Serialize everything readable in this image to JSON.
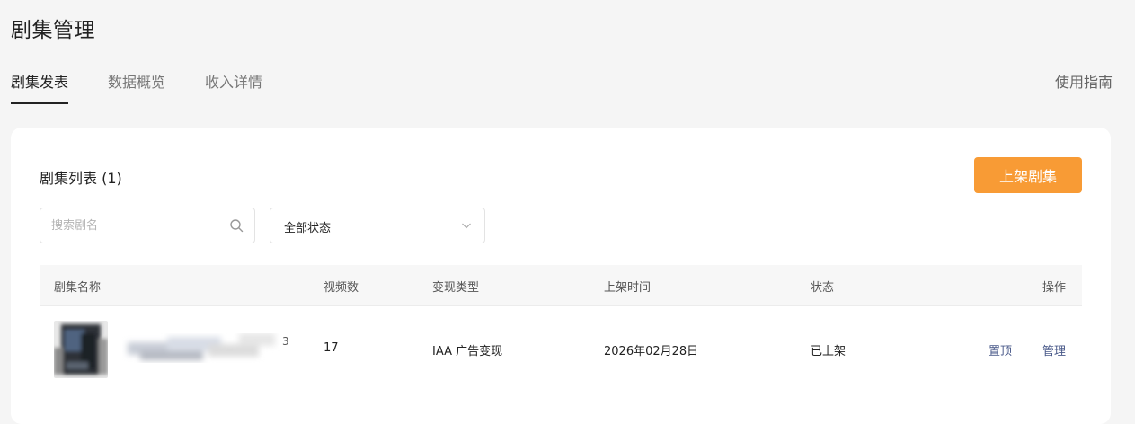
{
  "page": {
    "title": "剧集管理"
  },
  "tabs": [
    {
      "label": "剧集发表",
      "active": true
    },
    {
      "label": "数据概览",
      "active": false
    },
    {
      "label": "收入详情",
      "active": false
    }
  ],
  "guide_link": "使用指南",
  "list": {
    "title": "剧集列表 (1)",
    "publish_button": "上架剧集",
    "search": {
      "placeholder": "搜索剧名",
      "value": ""
    },
    "status_filter": {
      "selected": "全部状态"
    },
    "columns": [
      "剧集名称",
      "视频数",
      "变现类型",
      "上架时间",
      "状态",
      "操作"
    ],
    "rows": [
      {
        "name_visible": "3",
        "video_count": "17",
        "monetization": "IAA 广告变现",
        "listed_time": "2026年02月28日",
        "status": "已上架",
        "actions": [
          "置顶",
          "管理"
        ]
      }
    ]
  },
  "colors": {
    "accent": "#f89b35",
    "action_link": "#4a5a8a",
    "page_background": "#f5f5f5"
  },
  "icons": {
    "search": "search-icon",
    "dropdown": "chevron-down-icon"
  }
}
